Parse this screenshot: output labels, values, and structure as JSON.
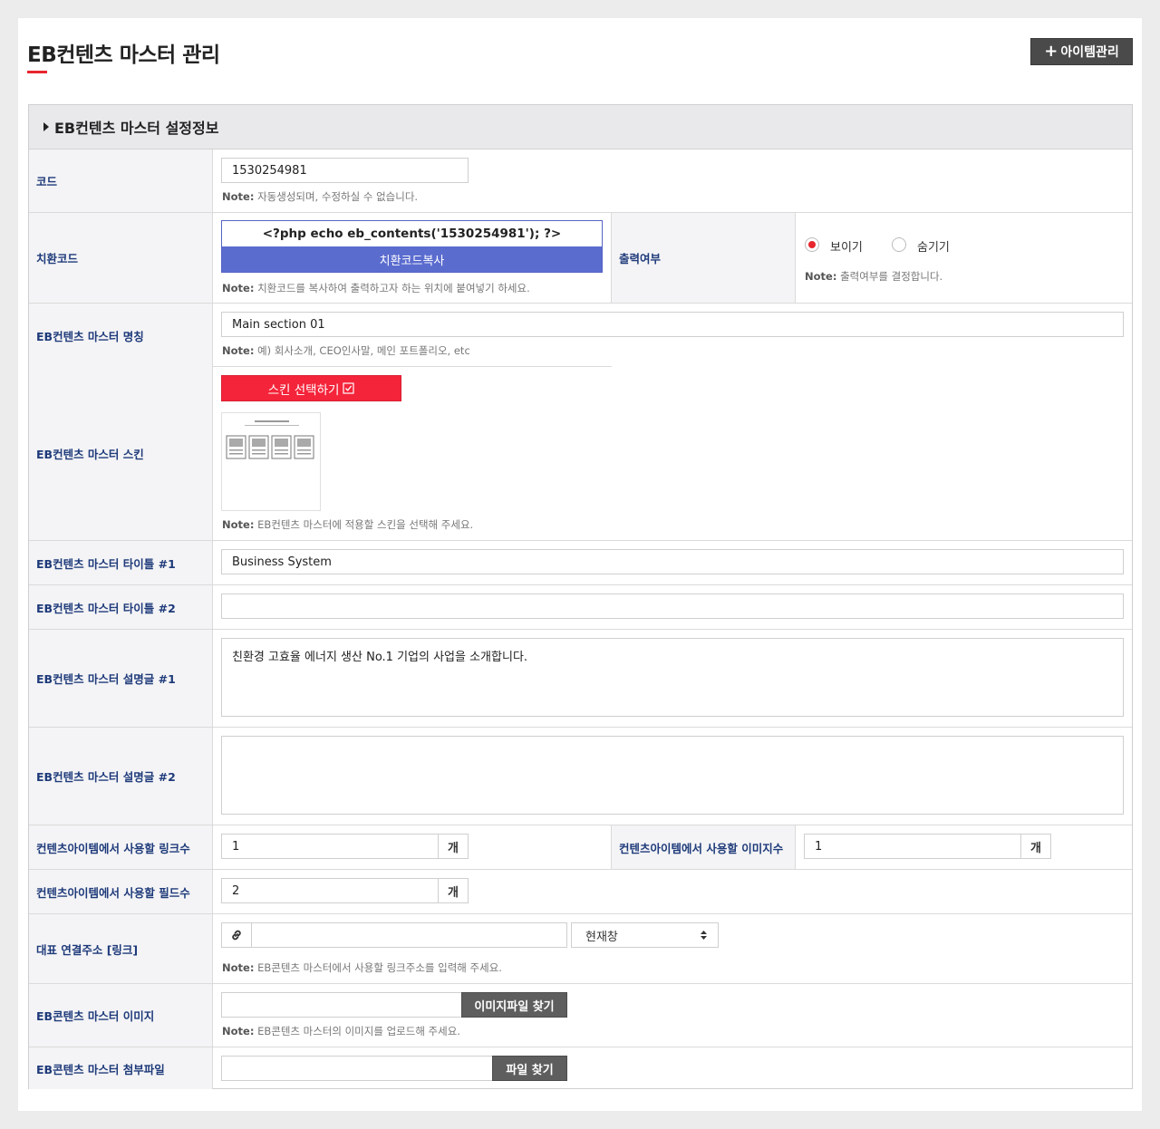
{
  "page": {
    "title": "EB컨텐츠 마스터 관리",
    "item_button": "아이템관리"
  },
  "section": {
    "title": "EB컨텐츠 마스터 설정정보"
  },
  "form": {
    "code": {
      "label": "코드",
      "value": "1530254981",
      "note_prefix": "Note:",
      "note": "자동생성되며, 수정하실 수 없습니다."
    },
    "replace_code": {
      "label": "치환코드",
      "code_text": "<?php echo eb_contents('1530254981'); ?>",
      "copy_button": "치환코드복사",
      "note_prefix": "Note:",
      "note": "치환코드를 복사하여 출력하고자 하는 위치에 붙여넣기 하세요."
    },
    "display": {
      "label": "출력여부",
      "options": [
        "보이기",
        "숨기기"
      ],
      "selected": "보이기",
      "note_prefix": "Note:",
      "note": "출력여부를 결정합니다."
    },
    "master_name": {
      "label": "EB컨텐츠 마스터 명칭",
      "value": "Main section 01",
      "note_prefix": "Note:",
      "note": "예) 회사소개, CEO인사말, 메인 포트폴리오, etc"
    },
    "skin": {
      "label": "EB컨텐츠 마스터 스킨",
      "button": "스킨 선택하기",
      "note_prefix": "Note:",
      "note": "EB컨텐츠 마스터에 적용할 스킨을 선택해 주세요."
    },
    "title1": {
      "label": "EB컨텐츠 마스터 타이틀 #1",
      "value": "Business System"
    },
    "title2": {
      "label": "EB컨텐츠 마스터 타이틀 #2",
      "value": ""
    },
    "desc1": {
      "label": "EB컨텐츠 마스터 설명글 #1",
      "value": "친환경 고효율 에너지 생산 No.1 기업의 사업을 소개합니다."
    },
    "desc2": {
      "label": "EB컨텐츠 마스터 설명글 #2",
      "value": ""
    },
    "link_count": {
      "label": "컨텐츠아이템에서 사용할 링크수",
      "value": "1",
      "unit": "개"
    },
    "image_count": {
      "label": "컨텐츠아이템에서 사용할 이미지수",
      "value": "1",
      "unit": "개"
    },
    "field_count": {
      "label": "컨텐츠아이템에서 사용할 필드수",
      "value": "2",
      "unit": "개"
    },
    "main_link": {
      "label": "대표 연결주소 [링크]",
      "value": "",
      "target": "현재창",
      "note_prefix": "Note:",
      "note": "EB콘텐츠 마스터에서 사용할 링크주소를 입력해 주세요."
    },
    "image": {
      "label": "EB콘텐츠 마스터 이미지",
      "button": "이미지파일 찾기",
      "note_prefix": "Note:",
      "note": "EB콘텐츠 마스터의 이미지를 업로드해 주세요."
    },
    "attachment": {
      "label": "EB콘텐츠 마스터 첨부파일",
      "button": "파일 찾기"
    }
  }
}
